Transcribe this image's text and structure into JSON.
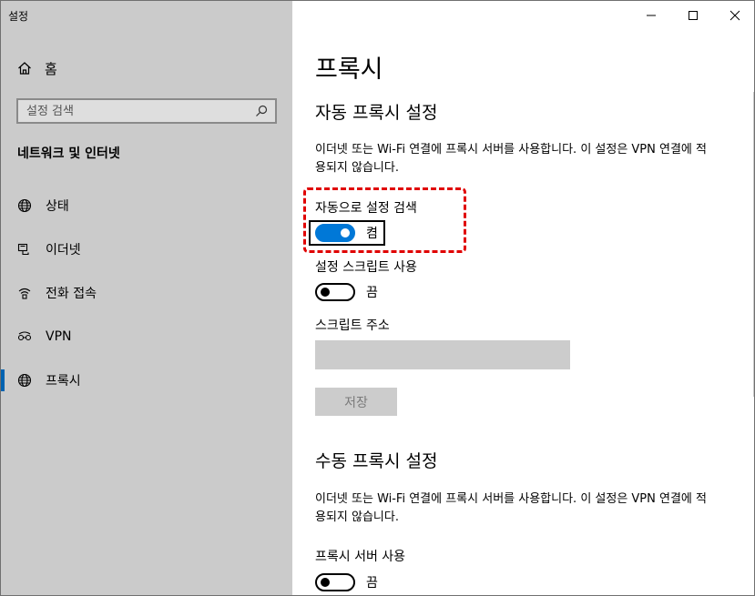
{
  "app_title": "설정",
  "sidebar": {
    "home_label": "홈",
    "search_placeholder": "설정 검색",
    "section_title": "네트워크 및 인터넷",
    "items": [
      {
        "label": "상태",
        "icon": "globe-icon"
      },
      {
        "label": "이더넷",
        "icon": "ethernet-icon"
      },
      {
        "label": "전화 접속",
        "icon": "dialup-icon"
      },
      {
        "label": "VPN",
        "icon": "vpn-icon"
      },
      {
        "label": "프록시",
        "icon": "globe-icon",
        "selected": true
      }
    ]
  },
  "main": {
    "title": "프록시",
    "auto": {
      "heading": "자동 프록시 설정",
      "description": "이더넷 또는 Wi-Fi 연결에 프록시 서버를 사용합니다. 이 설정은 VPN 연결에 적용되지 않습니다.",
      "detect_label": "자동으로 설정 검색",
      "detect_state": "켬",
      "script_label": "설정 스크립트 사용",
      "script_state": "끔",
      "address_label": "스크립트 주소",
      "address_value": "",
      "save_label": "저장"
    },
    "manual": {
      "heading": "수동 프록시 설정",
      "description": "이더넷 또는 Wi-Fi 연결에 프록시 서버를 사용합니다. 이 설정은 VPN 연결에 적용되지 않습니다.",
      "proxy_label": "프록시 서버 사용",
      "proxy_state": "끔"
    }
  },
  "colors": {
    "accent": "#0078d7",
    "sidebar_bg": "#cbcbcb",
    "highlight": "#e00000"
  }
}
